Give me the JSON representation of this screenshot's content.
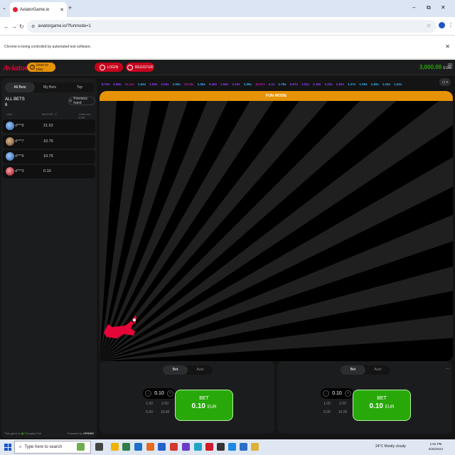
{
  "browser": {
    "tab_title": "AviatorGame.io",
    "url": "aviatorgame.io/?funmode=1",
    "infobar": "Chrome is being controlled by automated test software."
  },
  "header": {
    "logo": "Aviator",
    "how_to_play": "How to play",
    "login": "LOGIN",
    "register": "REGISTER",
    "balance": "3,000.00",
    "currency": "EUR"
  },
  "bets_panel": {
    "tabs": [
      "All Bets",
      "My Bets",
      "Top"
    ],
    "all_bets_label": "ALL BETS",
    "all_bets_count": "6",
    "previous_hand": "Previous hand",
    "col_user": "User",
    "col_bet": "Bet EUR",
    "col_x": "X",
    "col_cashout": "Cash out EUR",
    "rows": [
      {
        "user": "d***9",
        "bet": "21.52"
      },
      {
        "user": "d***7",
        "bet": "10.76"
      },
      {
        "user": "d***9",
        "bet": "10.75"
      },
      {
        "user": "d***3",
        "bet": "0.10"
      }
    ],
    "footer_provably": "This game is",
    "footer_fair": "Provably Fair",
    "footer_powered": "Powered by",
    "footer_brand": "SPRIBE"
  },
  "multipliers": [
    "8.76x",
    "5.98x",
    "11.11x",
    "1.52x",
    "2.59x",
    "2.53x",
    "1.00x",
    "10.34x",
    "1.35x",
    "5.48x",
    "2.56x",
    "2.22x",
    "1.05x",
    "16.67x",
    "4.1x",
    "1.76x",
    "6.97x",
    "2.01x",
    "2.19x",
    "3.22x",
    "2.92x",
    "1.27x",
    "1.09x",
    "1.83x",
    "1.15x",
    "1.02x"
  ],
  "stage": {
    "banner": "FUN MODE"
  },
  "bet_panels": [
    {
      "toggle": [
        "Bet",
        "Auto"
      ],
      "amount": "0.10",
      "quick": [
        "1.00",
        "2.00",
        "5.00",
        "10.00"
      ],
      "button_label": "BET",
      "button_amount": "0.10",
      "button_currency": "EUR"
    },
    {
      "toggle": [
        "Bet",
        "Auto"
      ],
      "amount": "0.10",
      "quick": [
        "1.00",
        "2.00",
        "5.00",
        "10.00"
      ],
      "button_label": "BET",
      "button_amount": "0.10",
      "button_currency": "EUR"
    }
  ],
  "taskbar": {
    "search_placeholder": "Type here to search",
    "weather": "24°C  Mostly cloudy",
    "time": "1:52 PM",
    "date": "6/25/2024"
  },
  "colors": {
    "brand_red": "#e50539",
    "accent_orange": "#e69308",
    "bet_green": "#28a909",
    "mult_blue": "#34b4ff",
    "mult_purple": "#913ef8",
    "mult_pink": "#c017b4"
  }
}
